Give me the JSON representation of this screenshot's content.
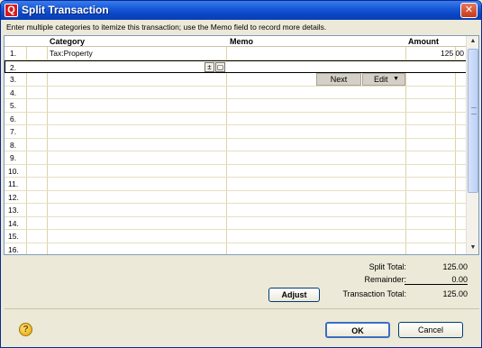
{
  "window": {
    "title": "Split Transaction",
    "close_glyph": "✕",
    "app_icon_glyph": "Q"
  },
  "instructions": "Enter multiple categories to itemize this transaction; use the Memo field to record more details.",
  "grid": {
    "headers": {
      "category": "Category",
      "memo": "Memo",
      "amount": "Amount"
    },
    "rows": [
      {
        "num": "1.",
        "category": "Tax:Property",
        "memo": "",
        "amount": "125 00"
      },
      {
        "num": "2.",
        "category": "",
        "memo": "",
        "amount": ""
      },
      {
        "num": "3.",
        "category": "",
        "memo": "",
        "amount": ""
      },
      {
        "num": "4.",
        "category": "",
        "memo": "",
        "amount": ""
      },
      {
        "num": "5.",
        "category": "",
        "memo": "",
        "amount": ""
      },
      {
        "num": "6.",
        "category": "",
        "memo": "",
        "amount": ""
      },
      {
        "num": "7.",
        "category": "",
        "memo": "",
        "amount": ""
      },
      {
        "num": "8.",
        "category": "",
        "memo": "",
        "amount": ""
      },
      {
        "num": "9.",
        "category": "",
        "memo": "",
        "amount": ""
      },
      {
        "num": "10.",
        "category": "",
        "memo": "",
        "amount": ""
      },
      {
        "num": "11.",
        "category": "",
        "memo": "",
        "amount": ""
      },
      {
        "num": "12.",
        "category": "",
        "memo": "",
        "amount": ""
      },
      {
        "num": "13.",
        "category": "",
        "memo": "",
        "amount": ""
      },
      {
        "num": "14.",
        "category": "",
        "memo": "",
        "amount": ""
      },
      {
        "num": "15.",
        "category": "",
        "memo": "",
        "amount": ""
      },
      {
        "num": "16.",
        "category": "",
        "memo": "",
        "amount": ""
      }
    ],
    "row_actions": {
      "next_label": "Next",
      "edit_label": "Edit",
      "edit_arrow": "▼"
    },
    "category_buttons": {
      "dropdown_glyph": "±",
      "calc_glyph": "▢"
    }
  },
  "totals": {
    "split_total_label": "Split Total:",
    "split_total_value": "125.00",
    "remainder_label": "Remainder:",
    "remainder_value": "0.00",
    "transaction_total_label": "Transaction Total:",
    "transaction_total_value": "125.00",
    "adjust_label": "Adjust"
  },
  "footer": {
    "help_glyph": "?",
    "ok_label": "OK",
    "cancel_label": "Cancel"
  },
  "scrollbar": {
    "up_glyph": "▲",
    "down_glyph": "▼"
  }
}
